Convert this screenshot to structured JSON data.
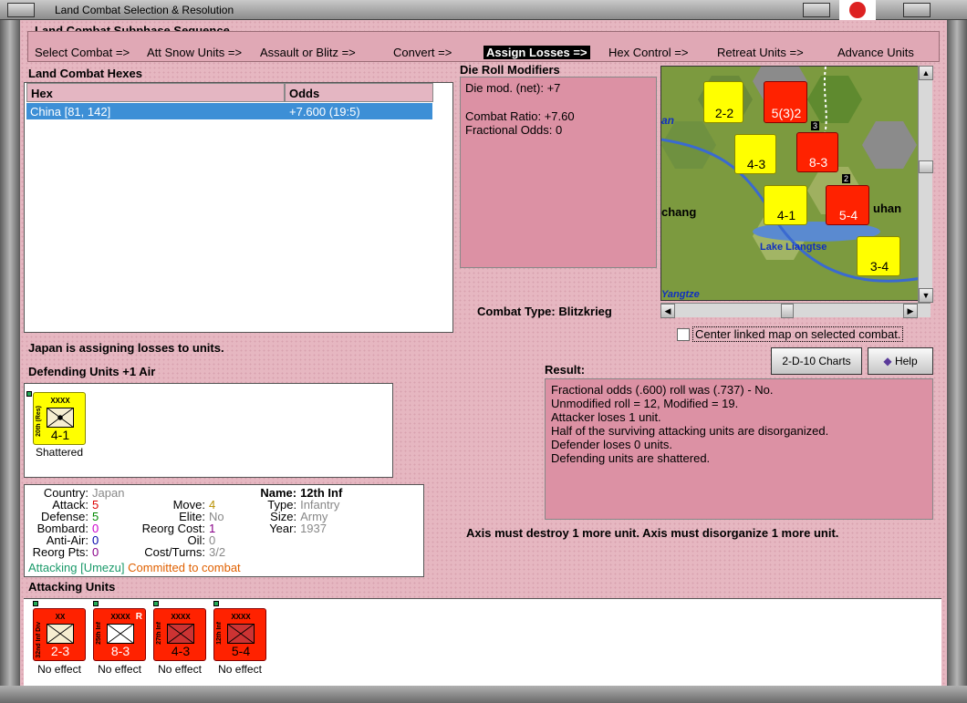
{
  "window": {
    "title": "Land Combat Selection & Resolution"
  },
  "sequence": {
    "title": "Land Combat Subphase Sequence",
    "steps": [
      "Select Combat =>",
      "Att Snow Units =>",
      "Assault or Blitz =>",
      "Convert =>",
      "Assign Losses =>",
      "Hex Control =>",
      "Retreat Units =>",
      "Advance Units"
    ],
    "active_index": 4
  },
  "hexes": {
    "title": "Land Combat Hexes",
    "columns": [
      "Hex",
      "Odds"
    ],
    "rows": [
      {
        "hex": "China [81, 142]",
        "odds": "+7.600 (19:5)"
      }
    ]
  },
  "modifiers": {
    "title": "Die Roll Modifiers",
    "lines": [
      "Die mod. (net): +7",
      "",
      "Combat Ratio: +7.60",
      "Fractional Odds: 0"
    ]
  },
  "combat_type": {
    "label": "Combat Type:",
    "value": "Blitzkrieg"
  },
  "center_map": {
    "label": "Center linked map on selected combat.",
    "checked": false
  },
  "status": "Japan is assigning losses to units.",
  "buttons": {
    "charts": "2-D-10 Charts",
    "help": "Help"
  },
  "defending": {
    "title": "Defending Units +1 Air",
    "units": [
      {
        "size": "XXXX",
        "name": "20th (Res)",
        "value": "4-1",
        "color": "yellow",
        "caption": "Shattered"
      }
    ]
  },
  "result": {
    "title": "Result:",
    "lines": [
      "Fractional odds (.600) roll was (.737)  - No.",
      "Unmodified roll = 12, Modified = 19.",
      "Attacker loses 1 unit.",
      "Half of the surviving attacking units are disorganized.",
      "Defender loses 0 units.",
      "Defending units are shattered."
    ],
    "summary": "Axis must destroy 1 more unit. Axis must disorganize 1 more unit."
  },
  "unit_info": {
    "country_label": "Country:",
    "country": "Japan",
    "name_label": "Name:",
    "name": "12th Inf",
    "attack_label": "Attack:",
    "attack": "5",
    "move_label": "Move:",
    "move": "4",
    "type_label": "Type:",
    "type": "Infantry",
    "defense_label": "Defense:",
    "defense": "5",
    "elite_label": "Elite:",
    "elite": "No",
    "size_label": "Size:",
    "size": "Army",
    "bombard_label": "Bombard:",
    "bombard": "0",
    "reorg_cost_label": "Reorg Cost:",
    "reorg_cost": "1",
    "year_label": "Year:",
    "year": "1937",
    "antiair_label": "Anti-Air:",
    "antiair": "0",
    "oil_label": "Oil:",
    "oil": "0",
    "reorg_pts_label": "Reorg Pts:",
    "reorg_pts": "0",
    "cost_turns_label": "Cost/Turns:",
    "cost_turns": "3/2",
    "attacking": "Attacking [Umezu]",
    "committed": "Committed to combat"
  },
  "attacking": {
    "title": "Attacking Units",
    "units": [
      {
        "size": "XX",
        "name": "32nd Inf Div",
        "value": "2-3",
        "caption": "No effect",
        "r": ""
      },
      {
        "size": "XXXX",
        "name": "25th Inf",
        "value": "8-3",
        "caption": "No effect",
        "r": "R"
      },
      {
        "size": "XXXX",
        "name": "27th Inf",
        "value": "4-3",
        "caption": "No effect",
        "r": ""
      },
      {
        "size": "XXXX",
        "name": "12th Inf",
        "value": "5-4",
        "caption": "No effect",
        "r": ""
      }
    ]
  },
  "map": {
    "labels": [
      "an",
      "chang",
      "uhan",
      "Lake Liangtse",
      "Yangtze"
    ],
    "counters": [
      "2-2",
      "5(3)2",
      "4-3",
      "8-3",
      "4-1",
      "5-4",
      "3-4"
    ],
    "stack_counts": [
      "3",
      "2"
    ]
  }
}
